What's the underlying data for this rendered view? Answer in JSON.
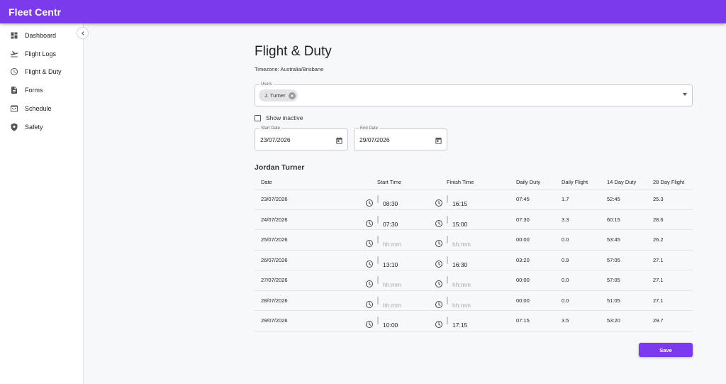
{
  "app": {
    "title": "Fleet Centr"
  },
  "colors": {
    "accent": "#7c3aed",
    "sidebar_bg": "#ffffff",
    "page_bg": "#f7f8fa"
  },
  "sidebar": {
    "items": [
      {
        "label": "Dashboard",
        "icon": "dashboard-icon"
      },
      {
        "label": "Flight Logs",
        "icon": "plane-departure-icon"
      },
      {
        "label": "Flight & Duty",
        "icon": "clock-icon"
      },
      {
        "label": "Forms",
        "icon": "document-icon"
      },
      {
        "label": "Schedule",
        "icon": "calendar-schedule-icon"
      },
      {
        "label": "Safety",
        "icon": "shield-icon"
      }
    ]
  },
  "page": {
    "title": "Flight & Duty",
    "timezone": "Timezone: Australia/Brisbane"
  },
  "filters": {
    "users_label": "Users",
    "selected_user": "J. Turner",
    "show_inactive_label": "Show inactive",
    "show_inactive_checked": false,
    "start_date_label": "Start Date",
    "start_date": "23/07/2026",
    "end_date_label": "End Date",
    "end_date": "29/07/2026"
  },
  "person": {
    "name": "Jordan Turner"
  },
  "table": {
    "headers": {
      "date": "Date",
      "start": "Start Time",
      "finish": "Finish Time",
      "daily_duty": "Daily Duty",
      "daily_flight": "Daily Flight",
      "duty_14": "14 Day Duty",
      "flight_28": "28 Day Flight"
    },
    "placeholder": "hh:mm",
    "rows": [
      {
        "date": "23/07/2026",
        "start": "08:30",
        "finish": "16:15",
        "daily_duty": "07:45",
        "daily_flight": "1.7",
        "duty_14": "52:45",
        "flight_28": "25.3"
      },
      {
        "date": "24/07/2026",
        "start": "07:30",
        "finish": "15:00",
        "daily_duty": "07:30",
        "daily_flight": "3.3",
        "duty_14": "60:15",
        "flight_28": "28.6"
      },
      {
        "date": "25/07/2026",
        "start": "",
        "finish": "",
        "daily_duty": "00:00",
        "daily_flight": "0.0",
        "duty_14": "53:45",
        "flight_28": "26.2"
      },
      {
        "date": "26/07/2026",
        "start": "13:10",
        "finish": "16:30",
        "daily_duty": "03:20",
        "daily_flight": "0.9",
        "duty_14": "57:05",
        "flight_28": "27.1"
      },
      {
        "date": "27/07/2026",
        "start": "",
        "finish": "",
        "daily_duty": "00:00",
        "daily_flight": "0.0",
        "duty_14": "57:05",
        "flight_28": "27.1"
      },
      {
        "date": "28/07/2026",
        "start": "",
        "finish": "",
        "daily_duty": "00:00",
        "daily_flight": "0.0",
        "duty_14": "51:05",
        "flight_28": "27.1"
      },
      {
        "date": "29/07/2026",
        "start": "10:00",
        "finish": "17:15",
        "daily_duty": "07:15",
        "daily_flight": "3.5",
        "duty_14": "53:20",
        "flight_28": "29.7"
      }
    ]
  },
  "actions": {
    "save_label": "Save"
  }
}
